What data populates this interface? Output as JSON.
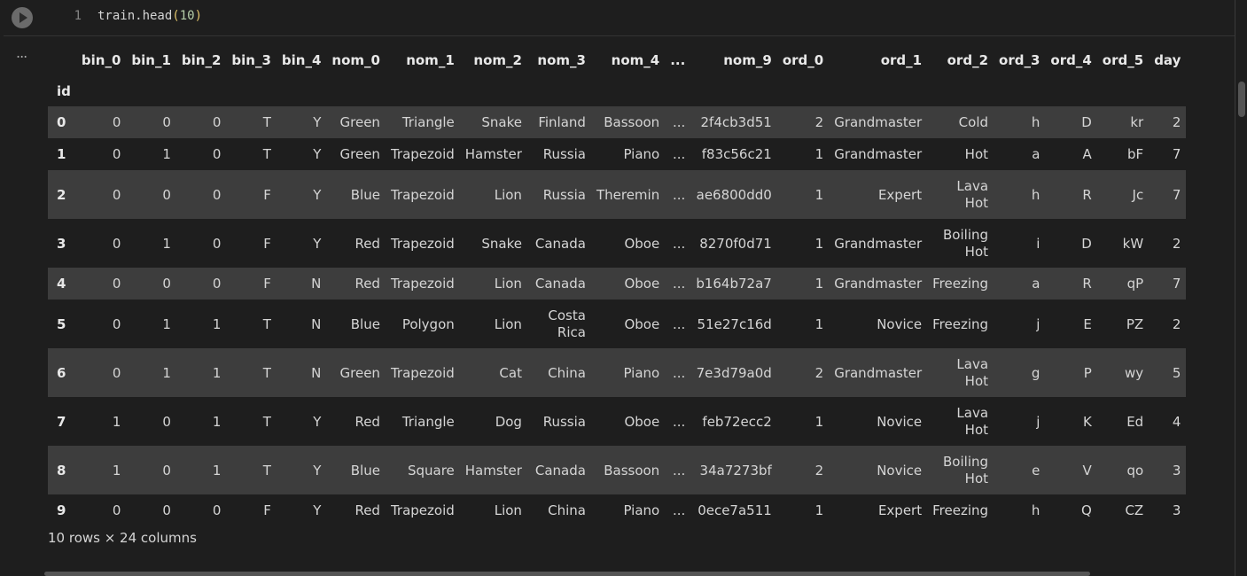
{
  "code_cell": {
    "line_number": "1",
    "code_prefix": "train.head",
    "code_open": "(",
    "code_arg": "10",
    "code_close": ")"
  },
  "output": {
    "menu_icon": "...",
    "index_name": "id",
    "columns": [
      "bin_0",
      "bin_1",
      "bin_2",
      "bin_3",
      "bin_4",
      "nom_0",
      "nom_1",
      "nom_2",
      "nom_3",
      "nom_4",
      "...",
      "nom_9",
      "ord_0",
      "ord_1",
      "ord_2",
      "ord_3",
      "ord_4",
      "ord_5",
      "day"
    ],
    "rows": [
      {
        "id": "0",
        "cells": [
          "0",
          "0",
          "0",
          "T",
          "Y",
          "Green",
          "Triangle",
          "Snake",
          "Finland",
          "Bassoon",
          "...",
          "2f4cb3d51",
          "2",
          "Grandmaster",
          "Cold",
          "h",
          "D",
          "kr",
          "2"
        ]
      },
      {
        "id": "1",
        "cells": [
          "0",
          "1",
          "0",
          "T",
          "Y",
          "Green",
          "Trapezoid",
          "Hamster",
          "Russia",
          "Piano",
          "...",
          "f83c56c21",
          "1",
          "Grandmaster",
          "Hot",
          "a",
          "A",
          "bF",
          "7"
        ]
      },
      {
        "id": "2",
        "cells": [
          "0",
          "0",
          "0",
          "F",
          "Y",
          "Blue",
          "Trapezoid",
          "Lion",
          "Russia",
          "Theremin",
          "...",
          "ae6800dd0",
          "1",
          "Expert",
          "Lava Hot",
          "h",
          "R",
          "Jc",
          "7"
        ]
      },
      {
        "id": "3",
        "cells": [
          "0",
          "1",
          "0",
          "F",
          "Y",
          "Red",
          "Trapezoid",
          "Snake",
          "Canada",
          "Oboe",
          "...",
          "8270f0d71",
          "1",
          "Grandmaster",
          "Boiling Hot",
          "i",
          "D",
          "kW",
          "2"
        ]
      },
      {
        "id": "4",
        "cells": [
          "0",
          "0",
          "0",
          "F",
          "N",
          "Red",
          "Trapezoid",
          "Lion",
          "Canada",
          "Oboe",
          "...",
          "b164b72a7",
          "1",
          "Grandmaster",
          "Freezing",
          "a",
          "R",
          "qP",
          "7"
        ]
      },
      {
        "id": "5",
        "cells": [
          "0",
          "1",
          "1",
          "T",
          "N",
          "Blue",
          "Polygon",
          "Lion",
          "Costa Rica",
          "Oboe",
          "...",
          "51e27c16d",
          "1",
          "Novice",
          "Freezing",
          "j",
          "E",
          "PZ",
          "2"
        ]
      },
      {
        "id": "6",
        "cells": [
          "0",
          "1",
          "1",
          "T",
          "N",
          "Green",
          "Trapezoid",
          "Cat",
          "China",
          "Piano",
          "...",
          "7e3d79a0d",
          "2",
          "Grandmaster",
          "Lava Hot",
          "g",
          "P",
          "wy",
          "5"
        ]
      },
      {
        "id": "7",
        "cells": [
          "1",
          "0",
          "1",
          "T",
          "Y",
          "Red",
          "Triangle",
          "Dog",
          "Russia",
          "Oboe",
          "...",
          "feb72ecc2",
          "1",
          "Novice",
          "Lava Hot",
          "j",
          "K",
          "Ed",
          "4"
        ]
      },
      {
        "id": "8",
        "cells": [
          "1",
          "0",
          "1",
          "T",
          "Y",
          "Blue",
          "Square",
          "Hamster",
          "Canada",
          "Bassoon",
          "...",
          "34a7273bf",
          "2",
          "Novice",
          "Boiling Hot",
          "e",
          "V",
          "qo",
          "3"
        ]
      },
      {
        "id": "9",
        "cells": [
          "0",
          "0",
          "0",
          "F",
          "Y",
          "Red",
          "Trapezoid",
          "Lion",
          "China",
          "Piano",
          "...",
          "0ece7a511",
          "1",
          "Expert",
          "Freezing",
          "h",
          "Q",
          "CZ",
          "3"
        ]
      }
    ],
    "footer": "10 rows × 24 columns"
  }
}
